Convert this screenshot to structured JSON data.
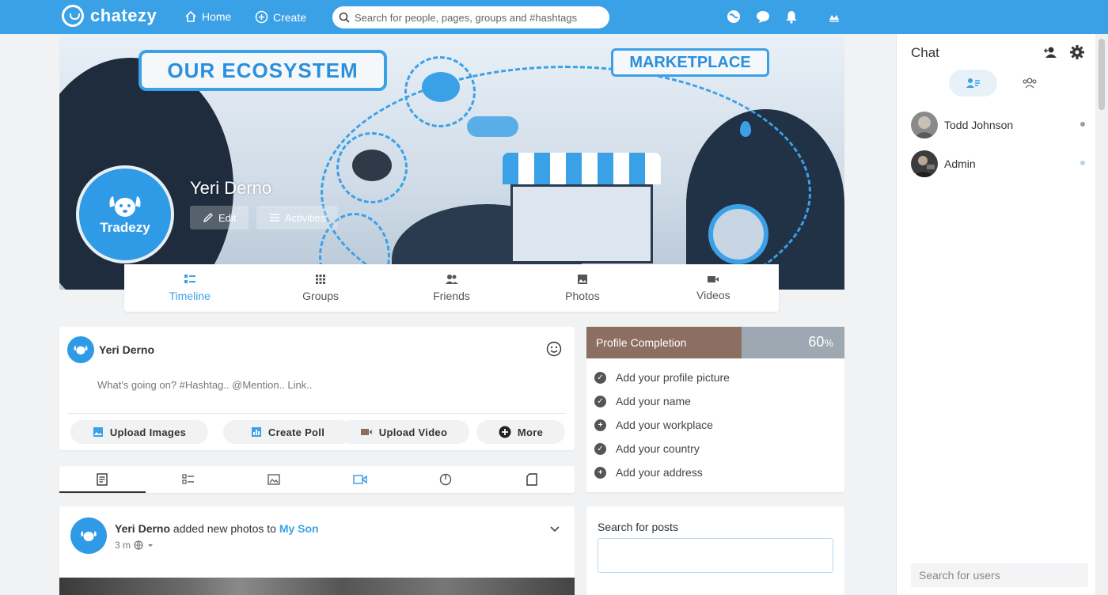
{
  "topbar": {
    "brand": "chatezy",
    "home_label": "Home",
    "create_label": "Create",
    "search_placeholder": "Search for people, pages, groups and #hashtags"
  },
  "profile": {
    "name": "Yeri Derno",
    "avatar_brand": "Tradezy",
    "edit_label": "Edit",
    "activities_label": "Activities",
    "cover": {
      "ecosystem_text": "OUR ECOSYSTEM",
      "marketplace_text": "MARKETPLACE"
    },
    "tabs": [
      {
        "label": "Timeline",
        "icon": "timeline-icon"
      },
      {
        "label": "Groups",
        "icon": "groups-icon"
      },
      {
        "label": "Friends",
        "icon": "friends-icon"
      },
      {
        "label": "Photos",
        "icon": "photos-icon"
      },
      {
        "label": "Videos",
        "icon": "videos-icon"
      }
    ]
  },
  "composer": {
    "author": "Yeri Derno",
    "placeholder": "What's going on? #Hashtag.. @Mention.. Link..",
    "buttons": {
      "upload_images": "Upload Images",
      "create_poll": "Create Poll",
      "upload_video": "Upload Video",
      "more": "More"
    }
  },
  "post": {
    "author": "Yeri Derno",
    "action": "added new photos to",
    "target": "My Son",
    "time": "3 m"
  },
  "completion": {
    "title": "Profile Completion",
    "percent": 60,
    "percent_number": "60",
    "percent_sign": "%",
    "items": [
      {
        "label": "Add your profile picture",
        "done": true
      },
      {
        "label": "Add your name",
        "done": true
      },
      {
        "label": "Add your workplace",
        "done": false
      },
      {
        "label": "Add your country",
        "done": true
      },
      {
        "label": "Add your address",
        "done": false
      }
    ]
  },
  "search_posts": {
    "label": "Search for posts"
  },
  "chat": {
    "title": "Chat",
    "users": [
      {
        "name": "Todd Johnson",
        "status_color": "#9e9e9e"
      },
      {
        "name": "Admin",
        "status_color": "#b8d4ea"
      }
    ],
    "search_placeholder": "Search for users"
  },
  "colors": {
    "accent": "#3ba1e6",
    "completion_fill": "#8d6e63",
    "completion_rest": "#9ea8b2"
  }
}
